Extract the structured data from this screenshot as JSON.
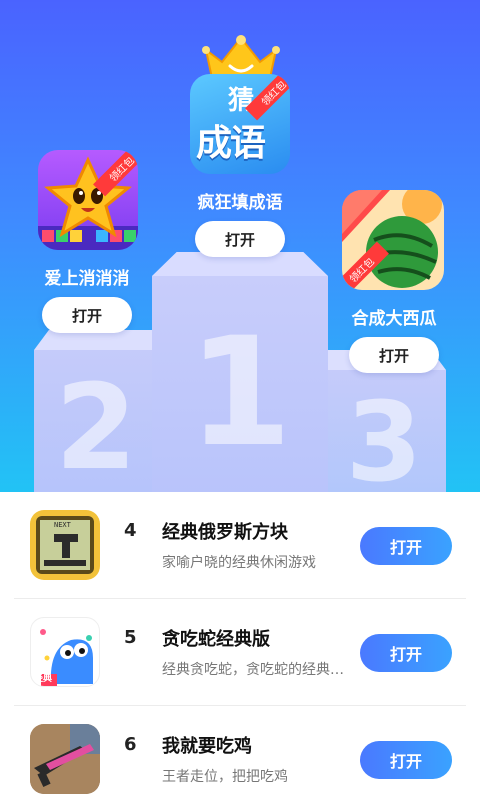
{
  "colors": {
    "header_top": "#4a63ff",
    "header_bottom": "#22c3f5",
    "button_gradient_start": "#4a79ff",
    "button_gradient_end": "#3aa2ff",
    "title_text": "#111111",
    "desc_text": "#777777"
  },
  "podium": {
    "first": {
      "rank_number": "1",
      "name": "疯狂填成语",
      "button_label": "打开",
      "icon": "idiom-game-icon",
      "icon_text_top": "猜",
      "icon_text_main": "成语",
      "badge": "领红包"
    },
    "second": {
      "rank_number": "2",
      "name": "爱上消消消",
      "button_label": "打开",
      "icon": "star-match-game-icon",
      "badge": "领红包"
    },
    "third": {
      "rank_number": "3",
      "name": "合成大西瓜",
      "button_label": "打开",
      "icon": "watermelon-game-icon",
      "badge": "领红包"
    }
  },
  "list": [
    {
      "rank": "4",
      "title": "经典俄罗斯方块",
      "description": "家喻户晓的经典休闲游戏",
      "button_label": "打开",
      "icon": "tetris-game-icon",
      "icon_label": "NEXT"
    },
    {
      "rank": "5",
      "title": "贪吃蛇经典版",
      "description": "经典贪吃蛇，贪吃蛇的经典玩法",
      "button_label": "打开",
      "icon": "snake-game-icon",
      "icon_label": "经典"
    },
    {
      "rank": "6",
      "title": "我就要吃鸡",
      "description": "王者走位，把把吃鸡",
      "button_label": "打开",
      "icon": "shooter-game-icon"
    }
  ]
}
